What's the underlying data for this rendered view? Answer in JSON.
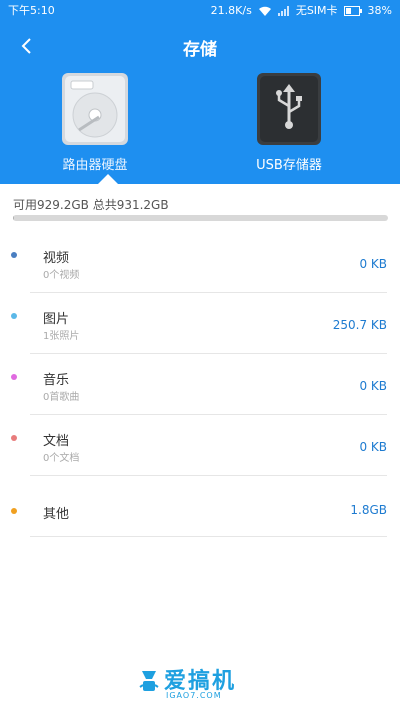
{
  "status_bar": {
    "time": "下午5:10",
    "speed": "21.8K/s",
    "sim": "无SIM卡",
    "battery": "38%"
  },
  "header": {
    "title": "存储"
  },
  "devices": [
    {
      "label": "路由器硬盘",
      "icon": "hard-drive-icon",
      "selected": true
    },
    {
      "label": "USB存储器",
      "icon": "usb-drive-icon",
      "selected": false
    }
  ],
  "capacity": {
    "text": "可用929.2GB 总共931.2GB",
    "used_fraction": 0.002
  },
  "categories": [
    {
      "name": "视频",
      "sub": "0个视频",
      "size": "0 KB",
      "color": "#4a7fc1"
    },
    {
      "name": "图片",
      "sub": "1张照片",
      "size": "250.7 KB",
      "color": "#5bb8e8"
    },
    {
      "name": "音乐",
      "sub": "0首歌曲",
      "size": "0 KB",
      "color": "#e06ae0"
    },
    {
      "name": "文档",
      "sub": "0个文档",
      "size": "0 KB",
      "color": "#e87c7c"
    },
    {
      "name": "其他",
      "sub": "",
      "size": "1.8GB",
      "color": "#f0a020"
    }
  ],
  "watermark": {
    "title": "爱搞机",
    "sub": "IGAO7.COM"
  },
  "colors": {
    "header_bg": "#1e8ff0",
    "accent_text": "#1e7bd0"
  }
}
